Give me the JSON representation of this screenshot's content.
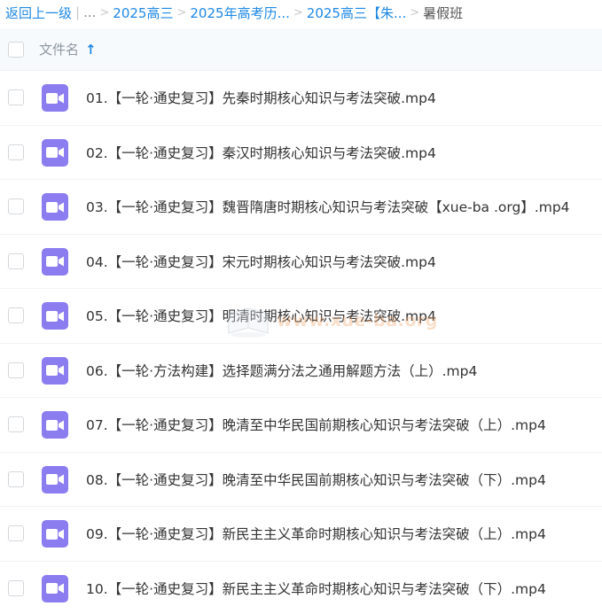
{
  "breadcrumb": {
    "back": "返回上一级",
    "pipe": "|",
    "ellipsis": "...",
    "sep": ">",
    "crumbs": [
      "2025高三",
      "2025年高考历...",
      "2025高三【朱..."
    ],
    "current": "暑假班"
  },
  "header": {
    "column_title": "文件名",
    "sort_arrow": "↑"
  },
  "files": [
    {
      "name": "01.【一轮·通史复习】先秦时期核心知识与考法突破.mp4",
      "type": "video"
    },
    {
      "name": "02.【一轮·通史复习】秦汉时期核心知识与考法突破.mp4",
      "type": "video"
    },
    {
      "name": "03.【一轮·通史复习】魏晋隋唐时期核心知识与考法突破【xue-ba .org】.mp4",
      "type": "video"
    },
    {
      "name": "04.【一轮·通史复习】宋元时期核心知识与考法突破.mp4",
      "type": "video"
    },
    {
      "name": "05.【一轮·通史复习】明清时期核心知识与考法突破.mp4",
      "type": "video"
    },
    {
      "name": "06.【一轮·方法构建】选择题满分法之通用解题方法（上）.mp4",
      "type": "video"
    },
    {
      "name": "07.【一轮·通史复习】晚清至中华民国前期核心知识与考法突破（上）.mp4",
      "type": "video"
    },
    {
      "name": "08.【一轮·通史复习】晚清至中华民国前期核心知识与考法突破（下）.mp4",
      "type": "video"
    },
    {
      "name": "09.【一轮·通史复习】新民主主义革命时期核心知识与考法突破（上）.mp4",
      "type": "video"
    },
    {
      "name": "10.【一轮·通史复习】新民主主义革命时期核心知识与考法突破（下）.mp4",
      "type": "video"
    }
  ],
  "watermark": {
    "text": "www.xue-ba.org"
  },
  "colors": {
    "link": "#1E88E5",
    "video_icon": "#8b7cf0",
    "header_bg": "#f7fafd"
  }
}
